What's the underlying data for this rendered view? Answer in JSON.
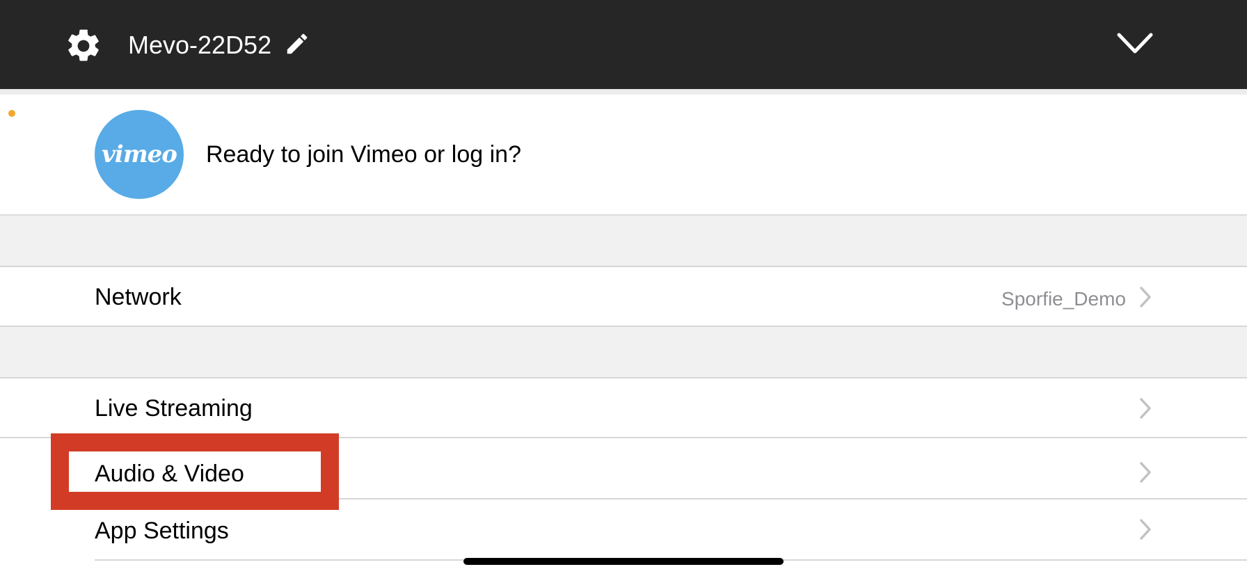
{
  "header": {
    "device_name": "Mevo-22D52",
    "background": "#262626",
    "icons": {
      "settings": "gear-icon",
      "edit": "pencil-icon",
      "collapse": "chevron-down-icon"
    }
  },
  "vimeo": {
    "logo_text": "vimeo",
    "prompt": "Ready to join Vimeo or log in?",
    "brand_color": "#58abe6"
  },
  "status_dot_color": "#f0a830",
  "rows": {
    "network": {
      "label": "Network",
      "value": "Sporfie_Demo"
    },
    "live_streaming": {
      "label": "Live Streaming"
    },
    "audio_video": {
      "label": "Audio & Video"
    },
    "app_settings": {
      "label": "App Settings"
    }
  },
  "highlight_color": "#d23c26"
}
